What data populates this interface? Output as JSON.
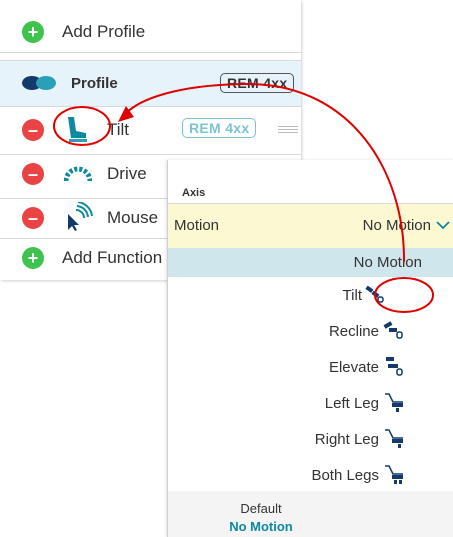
{
  "left_list": {
    "add_profile_label": "Add Profile",
    "profile": {
      "label": "Profile",
      "badge": "REM 4xx"
    },
    "functions": [
      {
        "label": "Tilt",
        "badge": "REM 4xx",
        "icon": "seat-icon"
      },
      {
        "label": "Drive",
        "icon": "drive-icon"
      },
      {
        "label": "Mouse",
        "icon": "mouse-cursor-icon"
      }
    ],
    "add_function_label": "Add Function"
  },
  "popup": {
    "axis_label": "Axis",
    "motion_label": "Motion",
    "motion_value": "No Motion",
    "options": [
      "No Motion",
      "Tilt",
      "Recline",
      "Elevate",
      "Left Leg",
      "Right Leg",
      "Both Legs"
    ],
    "default_label": "Default",
    "default_value": "No Motion"
  },
  "colors": {
    "accent_teal": "#0d8aa0",
    "profile_row_bg": "#e6f3fa",
    "motion_row_bg": "#fbf8d2",
    "selected_option_bg": "#cfe6ec",
    "annotation_red": "#e00000",
    "icon_navy": "#123a6b"
  }
}
